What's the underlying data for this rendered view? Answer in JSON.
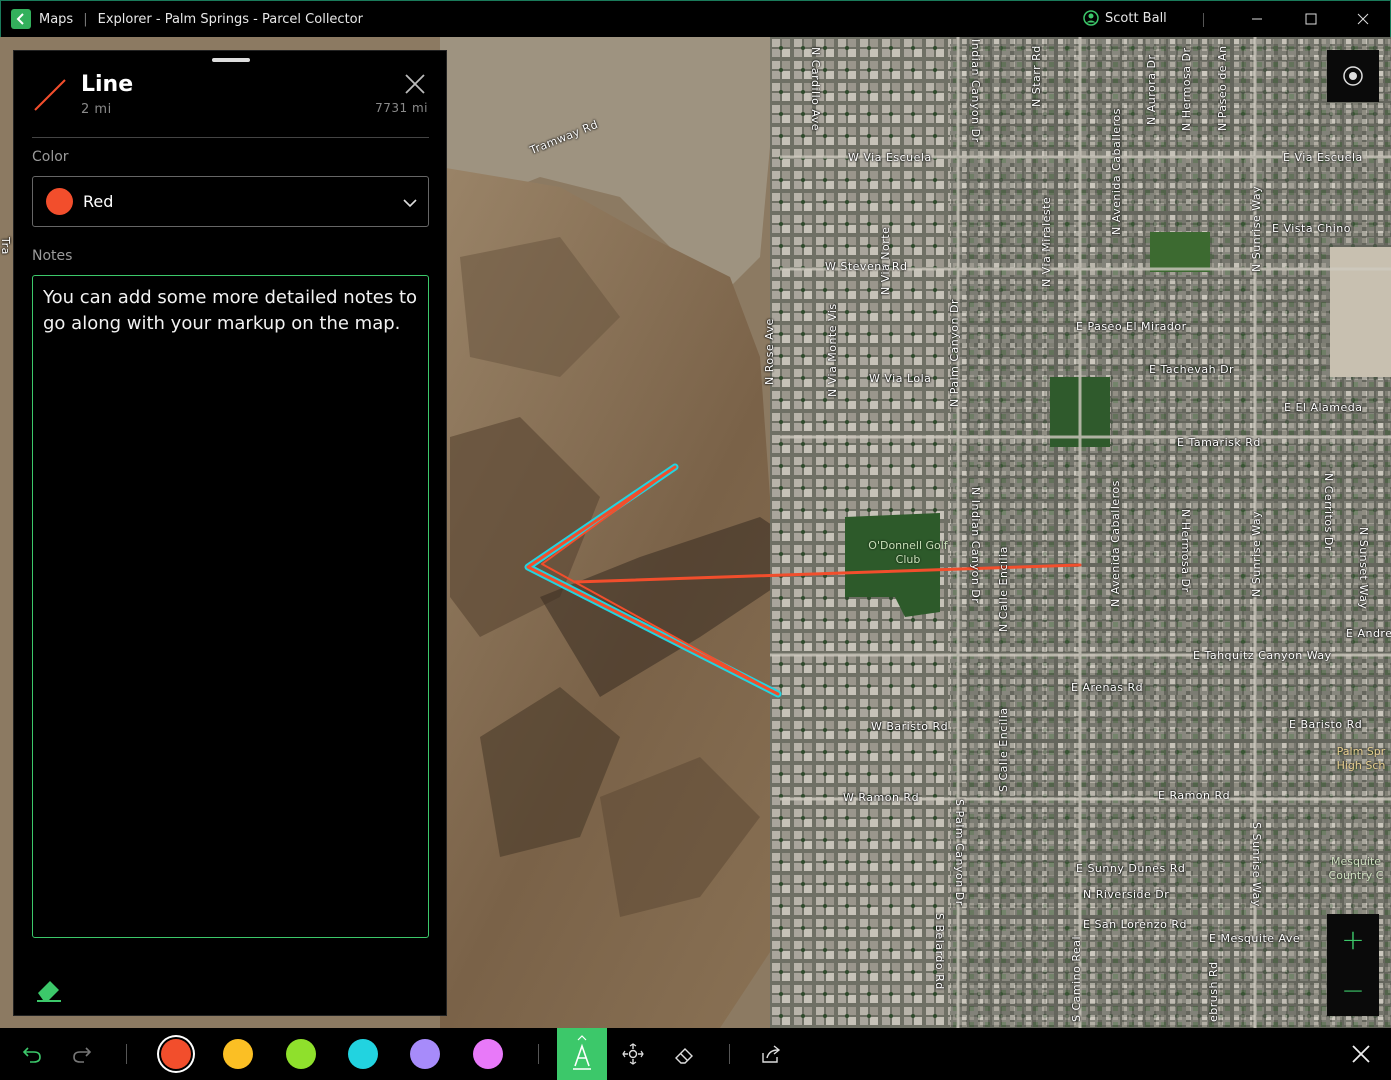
{
  "titlebar": {
    "app_name": "Maps",
    "separator": "|",
    "window_title": "Explorer - Palm Springs - Parcel Collector",
    "user_name": "Scott Ball"
  },
  "map": {
    "streets": [
      {
        "text": "N Cardillo Ave"
      },
      {
        "text": "Tramway Rd"
      },
      {
        "text": "W Via Escuela"
      },
      {
        "text": "W Stevens Rd"
      },
      {
        "text": "N Via Norte"
      },
      {
        "text": "N Via Monte Vis"
      },
      {
        "text": "N Rose Ave"
      },
      {
        "text": "W Via Lola"
      },
      {
        "text": "N Palm Canyon Dr"
      },
      {
        "text": "Indian Canyon Dr"
      },
      {
        "text": "N Starr Rd"
      },
      {
        "text": "N Via Miraleste"
      },
      {
        "text": "N Avenida Caballeros"
      },
      {
        "text": "N Aurora Dr"
      },
      {
        "text": "N Hermosa Dr"
      },
      {
        "text": "N Paseo de An"
      },
      {
        "text": "E Via Escuela"
      },
      {
        "text": "E Vista Chino"
      },
      {
        "text": "N Sunrise Way"
      },
      {
        "text": "E Paseo El Mirador"
      },
      {
        "text": "E Tachevah Dr"
      },
      {
        "text": "E El Alameda"
      },
      {
        "text": "E Tamarisk Rd"
      },
      {
        "text": "N Indian Canyon Dr"
      },
      {
        "text": "N Calle Encilia"
      },
      {
        "text": "N Avenida Caballeros"
      },
      {
        "text": "N Hermosa Dr"
      },
      {
        "text": "N Sunrise Way"
      },
      {
        "text": "N Cerritos Dr"
      },
      {
        "text": "N Sunset Way"
      },
      {
        "text": "E Andrea"
      },
      {
        "text": "E Tahquitz Canyon Way"
      },
      {
        "text": "E Arenas Rd"
      },
      {
        "text": "W Baristo Rd"
      },
      {
        "text": "E Baristo Rd"
      },
      {
        "text": "S Calle Encilia"
      },
      {
        "text": "W Ramon Rd"
      },
      {
        "text": "E Ramon Rd"
      },
      {
        "text": "S Palm Canyon Dr"
      },
      {
        "text": "S Sunrise Way"
      },
      {
        "text": "E Sunny Dunes Rd"
      },
      {
        "text": "N Riverside Dr"
      },
      {
        "text": "E San Lorenzo Rd"
      },
      {
        "text": "E Mesquite Ave"
      },
      {
        "text": "S Belardo Rd"
      },
      {
        "text": "S Camino Real"
      },
      {
        "text": "ebrush Rd"
      },
      {
        "text": "Tra"
      }
    ],
    "pois": [
      {
        "text": "O'Donnell Golf Club"
      },
      {
        "text": "Palm Spr High Sch"
      },
      {
        "text": "Mesquite Country C"
      }
    ],
    "zoom_in": "+",
    "zoom_out": "−"
  },
  "panel": {
    "title": "Line",
    "subtitle": "2 mi",
    "length": "7731 mi",
    "color_label": "Color",
    "color_value": "Red",
    "notes_label": "Notes",
    "notes_text": "You can add some more detailed notes to go along with your markup on the map."
  },
  "toolbar": {
    "swatches": [
      {
        "name": "red",
        "color": "#f24e2c",
        "selected": true
      },
      {
        "name": "yellow",
        "color": "#fbbf24",
        "selected": false
      },
      {
        "name": "green",
        "color": "#8fe02c",
        "selected": false
      },
      {
        "name": "cyan",
        "color": "#22d3e0",
        "selected": false
      },
      {
        "name": "purple",
        "color": "#a78bfa",
        "selected": false
      },
      {
        "name": "pink",
        "color": "#e879f9",
        "selected": false
      }
    ]
  },
  "colors": {
    "accent": "#3cc86a",
    "markup_red": "#f24e2c",
    "selection_cyan": "#22d3e0"
  }
}
